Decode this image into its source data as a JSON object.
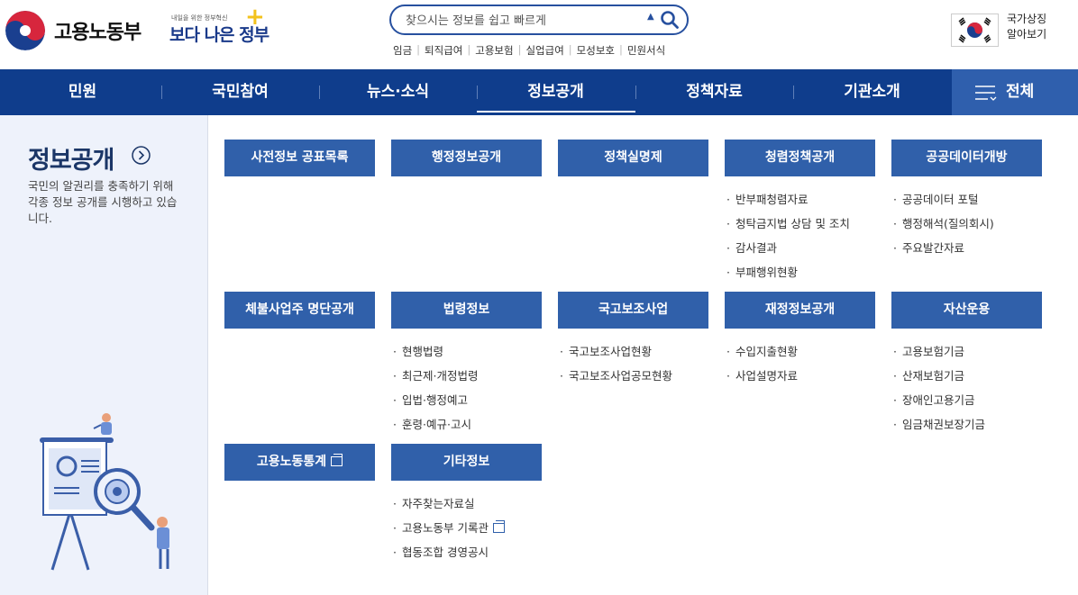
{
  "header": {
    "logo_text": "고용노동부",
    "slogan_small": "내일을 위한 정부혁신",
    "slogan_big": "보다 나은 정부",
    "search_placeholder": "찾으시는 정보를 쉽고 빠르게",
    "quick_links": [
      "임금",
      "퇴직급여",
      "고용보험",
      "실업급여",
      "모성보호",
      "민원서식"
    ],
    "national_symbol_line1": "국가상징",
    "national_symbol_line2": "알아보기"
  },
  "nav": {
    "items": [
      "민원",
      "국민참여",
      "뉴스·소식",
      "정보공개",
      "정책자료",
      "기관소개"
    ],
    "active_index": 3,
    "all_label": "전체"
  },
  "sidebar": {
    "title": "정보공개",
    "description": "국민의 알권리를 충족하기 위해 각종 정보 공개를 시행하고 있습니다."
  },
  "categories": [
    {
      "title": "사전정보 공표목록",
      "items": []
    },
    {
      "title": "행정정보공개",
      "items": []
    },
    {
      "title": "정책실명제",
      "items": []
    },
    {
      "title": "청렴정책공개",
      "items": [
        "반부패청렴자료",
        "청탁금지법 상담 및 조치",
        "감사결과",
        "부패행위현황"
      ]
    },
    {
      "title": "공공데이터개방",
      "items": [
        "공공데이터 포털",
        "행정해석(질의회시)",
        "주요발간자료"
      ]
    },
    {
      "title": "체불사업주 명단공개",
      "items": []
    },
    {
      "title": "법령정보",
      "items": [
        "현행법령",
        "최근제·개정법령",
        "입법·행정예고",
        "훈령·예규·고시"
      ]
    },
    {
      "title": "국고보조사업",
      "items": [
        "국고보조사업현황",
        "국고보조사업공모현황"
      ]
    },
    {
      "title": "재정정보공개",
      "items": [
        "수입지출현황",
        "사업설명자료"
      ]
    },
    {
      "title": "자산운용",
      "items": [
        "고용보험기금",
        "산재보험기금",
        "장애인고용기금",
        "임금채권보장기금"
      ]
    },
    {
      "title": "고용노동통계",
      "items": []
    },
    {
      "title": "기타정보",
      "items": [
        "자주찾는자료실",
        "고용노동부 기록관",
        "협동조합 경영공시"
      ]
    }
  ],
  "colors": {
    "nav_bg": "#0f3d8c",
    "accent": "#3060aa",
    "sidebar_bg": "#eef2fb"
  }
}
